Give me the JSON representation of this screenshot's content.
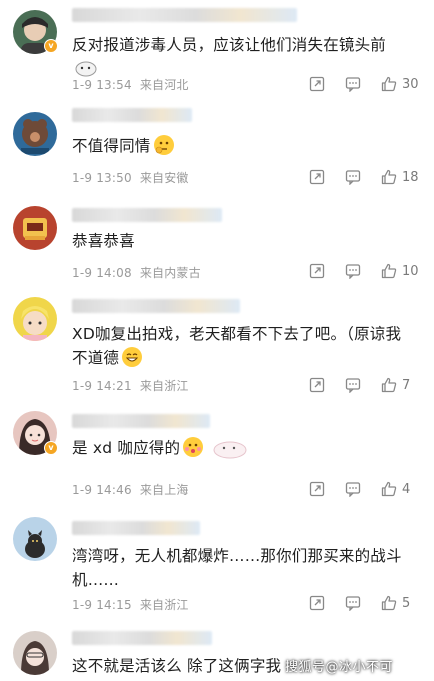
{
  "comments": [
    {
      "text": "反对报道涉毒人员，应该让他们消失在镜头前",
      "time": "1-9 13:54",
      "location": "来自河北",
      "likes": "30",
      "avatar_color": "#4a6e55",
      "verified": true
    },
    {
      "text": "不值得同情",
      "time": "1-9 13:50",
      "location": "来自安徽",
      "likes": "18",
      "avatar_color": "#2f6a9a",
      "verified": false
    },
    {
      "text": "恭喜恭喜",
      "time": "1-9 14:08",
      "location": "来自内蒙古",
      "likes": "10",
      "avatar_color": "#b8432e",
      "verified": false
    },
    {
      "text_line1": "XD咖复出拍戏，老天都看不下去了吧。（原谅我",
      "text_line2": "不道德",
      "time": "1-9 14:21",
      "location": "来自浙江",
      "likes": "7",
      "avatar_color": "#f0d64a",
      "verified": false
    },
    {
      "text": "是 xd 咖应得的",
      "time": "1-9 14:46",
      "location": "来自上海",
      "likes": "4",
      "avatar_color": "#e7c6c0",
      "verified": true
    },
    {
      "text_line1": "湾湾呀，无人机都爆炸……那你们那买来的战斗",
      "text_line2": "机……",
      "time": "1-9 14:15",
      "location": "来自浙江",
      "likes": "5",
      "avatar_color": "#b9d3e8",
      "verified": false
    },
    {
      "text": "这不就是活该么 除了这俩字我",
      "avatar_color": "#d9cfc9",
      "verified": false
    }
  ],
  "watermark": "搜狐号@冰小不可",
  "colors": {
    "text": "#1f1f1f",
    "meta": "#9a9a9a",
    "verified": "#f5a623"
  },
  "icons": {
    "share": "share-icon",
    "comment": "comment-icon",
    "like": "thumbs-up-icon"
  }
}
